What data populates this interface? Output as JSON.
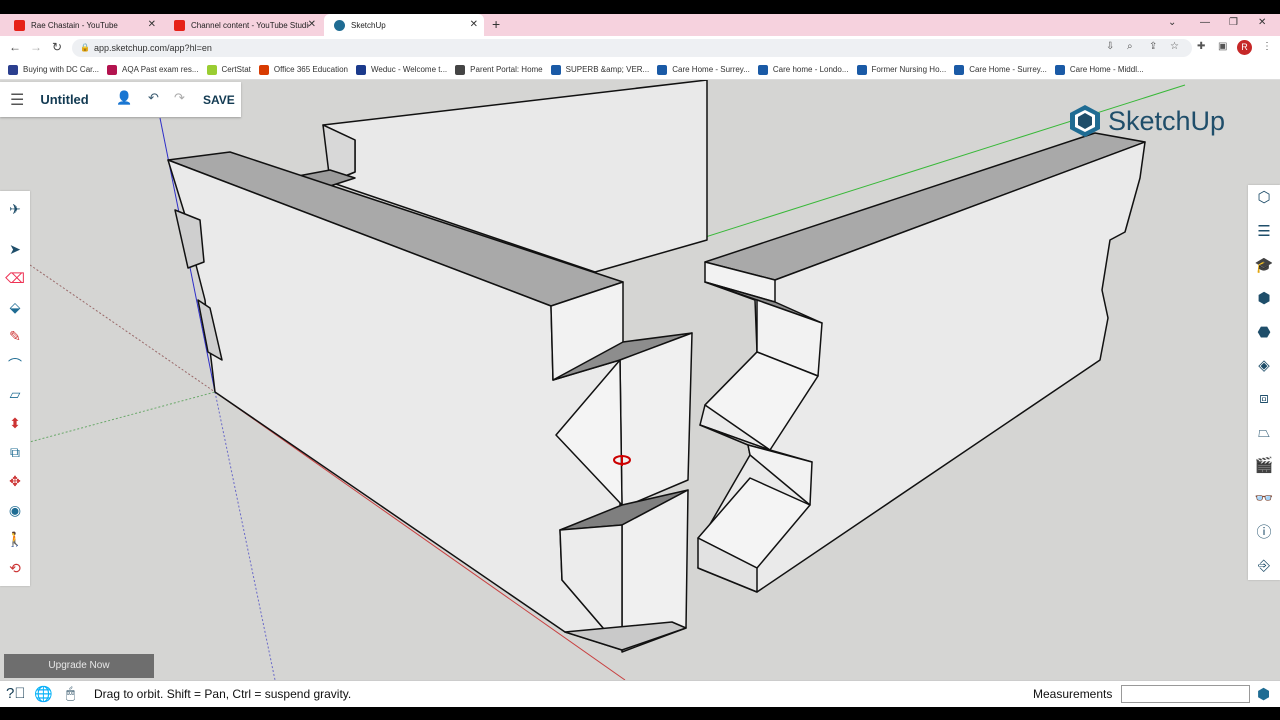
{
  "browser": {
    "tabs": [
      {
        "title": "Rae Chastain - YouTube",
        "favicon": "youtube-icon",
        "color": "#e62117"
      },
      {
        "title": "Channel content - YouTube Studio",
        "favicon": "youtube-icon",
        "color": "#e62117"
      },
      {
        "title": "SketchUp",
        "favicon": "sketchup-icon",
        "color": "#1f6c93"
      }
    ],
    "url": "app.sketchup.com/app?hl=en",
    "bookmarks": [
      {
        "label": "Buying with DC Car...",
        "color": "#2b3f8f"
      },
      {
        "label": "AQA Past exam res...",
        "color": "#b3134f"
      },
      {
        "label": "CertStat",
        "color": "#9acd32"
      },
      {
        "label": "Office 365 Education",
        "color": "#d83b01"
      },
      {
        "label": "Weduc - Welcome t...",
        "color": "#1b3a8c"
      },
      {
        "label": "Parent Portal: Home",
        "color": "#444444"
      },
      {
        "label": "SUPERB &amp; VER...",
        "color": "#1a5aa6"
      },
      {
        "label": "Care Home - Surrey...",
        "color": "#1a5aa6"
      },
      {
        "label": "Care home - Londo...",
        "color": "#1a5aa6"
      },
      {
        "label": "Former Nursing Ho...",
        "color": "#1a5aa6"
      },
      {
        "label": "Care Home - Surrey...",
        "color": "#1a5aa6"
      },
      {
        "label": "Care Home - Middl...",
        "color": "#1a5aa6"
      }
    ],
    "profile_initial": "R"
  },
  "app": {
    "model_name": "Untitled",
    "save_label": "SAVE",
    "brand": "SketchUp",
    "brand_color": "#1f4e6a",
    "upgrade_label": "Upgrade Now",
    "status_hint": "Drag to orbit. Shift = Pan, Ctrl = suspend gravity.",
    "measurements_label": "Measurements",
    "measurements_value": ""
  }
}
